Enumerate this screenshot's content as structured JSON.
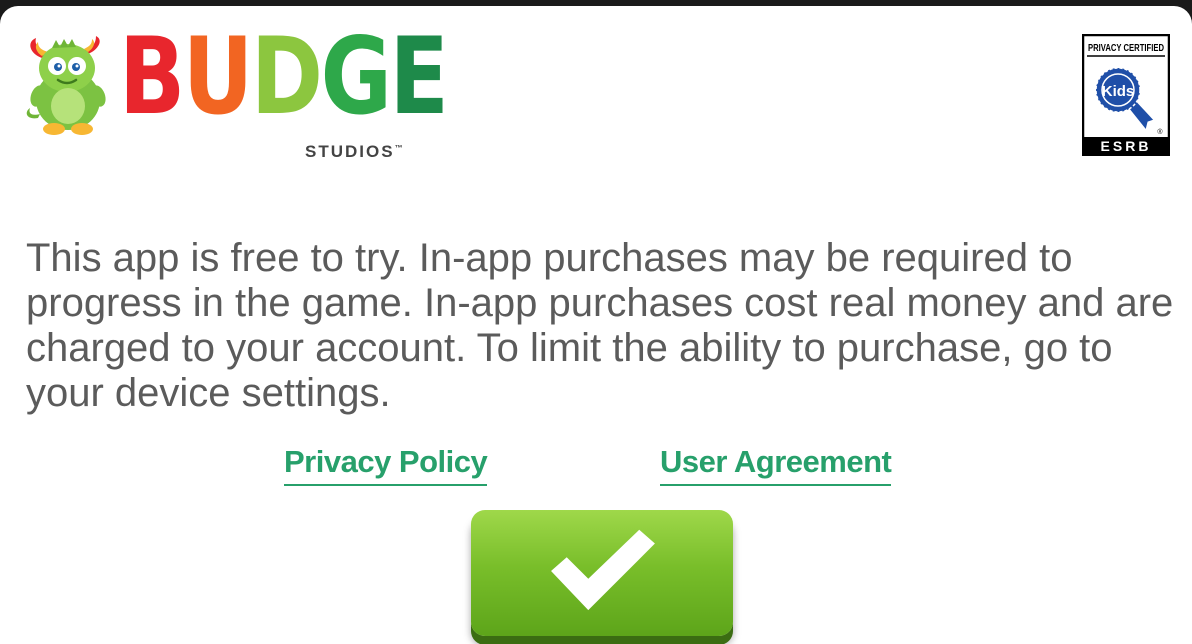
{
  "brand": {
    "wordmark_letters": [
      {
        "char": "B",
        "color": "#e8262d"
      },
      {
        "char": "U",
        "color": "#f26522"
      },
      {
        "char": "D",
        "color": "#8cc63f"
      },
      {
        "char": "G",
        "color": "#2ea84a"
      },
      {
        "char": "E",
        "color": "#1e8a4a"
      }
    ],
    "subtitle": "STUDIOS",
    "trademark": "™"
  },
  "badge": {
    "top_text": "PRIVACY CERTIFIED",
    "seal_text": "Kids",
    "registered": "®",
    "bottom_text": "ESRB"
  },
  "notice": {
    "text": "This app is free to try. In-app purchases may be required to progress in the game. In-app purchases cost real money and are charged to your account. To limit the ability to purchase, go to your device settings."
  },
  "links": {
    "privacy_label": "Privacy Policy",
    "agreement_label": "User Agreement"
  },
  "confirm_button": {
    "icon": "checkmark-icon"
  },
  "colors": {
    "link_green": "#27a06b",
    "button_green": "#79be2a",
    "text_gray": "#5b5b5b"
  }
}
